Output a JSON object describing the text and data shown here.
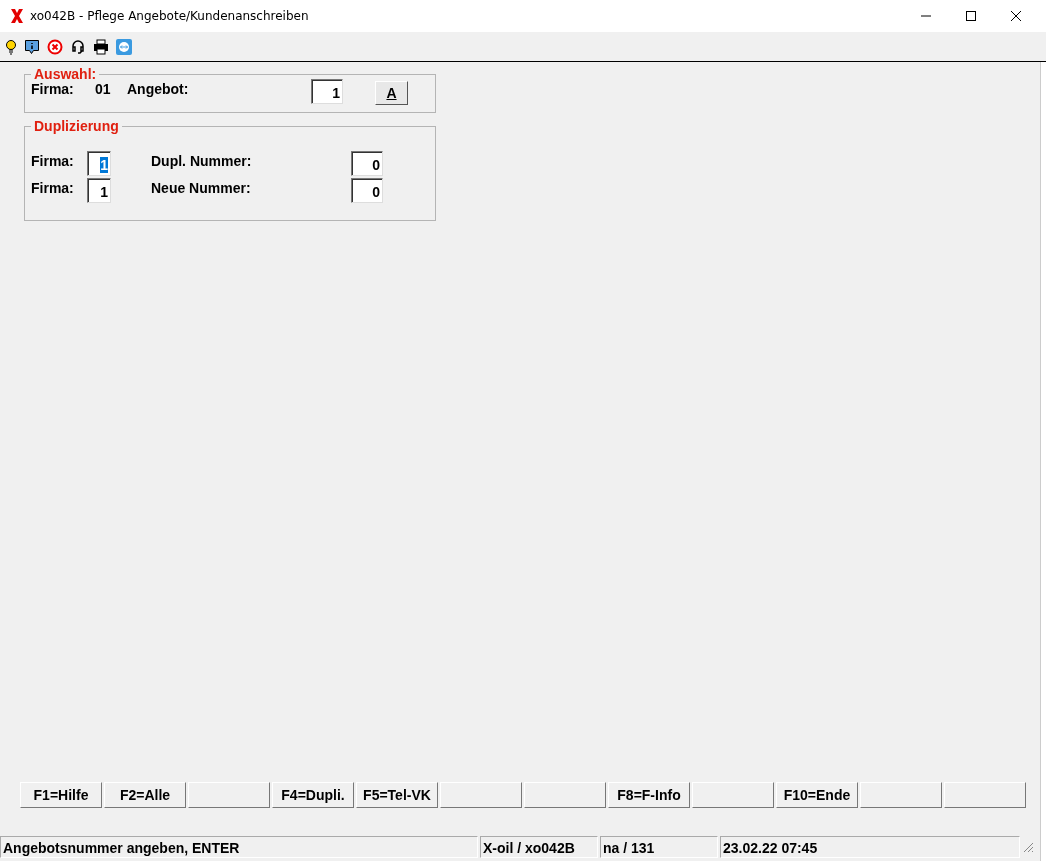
{
  "window": {
    "title": "xo042B - Pflege Angebote/Kundenanschreiben"
  },
  "auswahl": {
    "legend": "Auswahl:",
    "firma_label": "Firma:",
    "firma_value": "01",
    "angebot_label": "Angebot:",
    "angebot_value": "1",
    "button": "A"
  },
  "duplizierung": {
    "legend": "Duplizierung",
    "rows": [
      {
        "firma_label": "Firma:",
        "firma_value": "1",
        "firma_selected": true,
        "label": "Dupl. Nummer:",
        "value": "0"
      },
      {
        "firma_label": "Firma:",
        "firma_value": "1",
        "firma_selected": false,
        "label": "Neue Nummer:",
        "value": "0"
      }
    ]
  },
  "function_keys": [
    {
      "kind": "key",
      "label": "F1=Hilfe"
    },
    {
      "kind": "key",
      "label": "F2=Alle"
    },
    {
      "kind": "blank"
    },
    {
      "kind": "key",
      "label": "F4=Dupli."
    },
    {
      "kind": "key",
      "label": "F5=Tel-VK"
    },
    {
      "kind": "blank"
    },
    {
      "kind": "blank"
    },
    {
      "kind": "key",
      "label": "F8=F-Info"
    },
    {
      "kind": "blank"
    },
    {
      "kind": "key",
      "label": "F10=Ende"
    },
    {
      "kind": "blank"
    },
    {
      "kind": "blank"
    }
  ],
  "status_bar": {
    "message": "Angebotsnummer angeben, ENTER",
    "program": "X-oil / xo042B",
    "user": "na / 131",
    "datetime": "23.02.22 07:45"
  }
}
